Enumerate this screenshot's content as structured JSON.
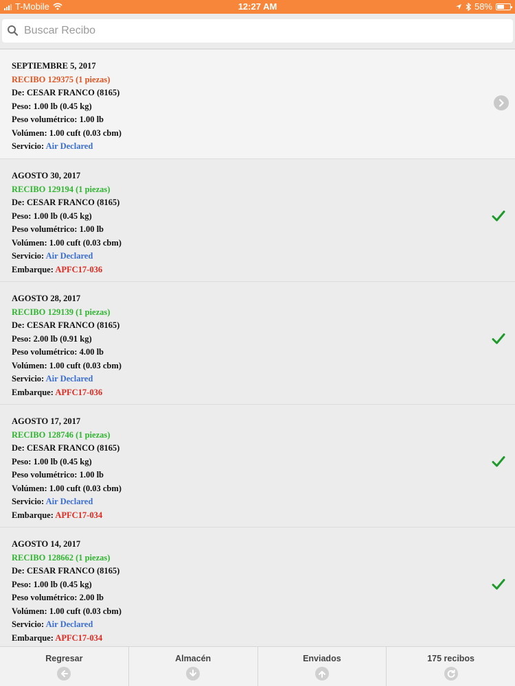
{
  "status_bar": {
    "carrier": "T-Mobile",
    "time": "12:27 AM",
    "battery": "58%",
    "battery_level": 0.58,
    "icons": [
      "signal-icon",
      "wifi-icon",
      "location-icon",
      "bluetooth-icon",
      "battery-icon"
    ]
  },
  "search": {
    "placeholder": "Buscar Recibo",
    "value": ""
  },
  "labels": {
    "de": "De:",
    "peso": "Peso:",
    "peso_vol": "Peso volumétrico:",
    "volumen": "Volúmen:",
    "servicio": "Servicio:",
    "embarque": "Embarque:"
  },
  "receipts": [
    {
      "date": "SEPTIEMBRE 5, 2017",
      "recibo": "RECIBO 129375 (1 piezas)",
      "de": "CESAR FRANCO (8165)",
      "peso": "1.00 lb (0.45 kg)",
      "peso_vol": "1.00 lb",
      "volumen": "1.00 cuft (0.03 cbm)",
      "servicio": "Air Declared",
      "embarque": "",
      "status_icon": "chevron-right-icon",
      "recibo_color": "#e0531f"
    },
    {
      "date": "AGOSTO 30, 2017",
      "recibo": "RECIBO 129194 (1 piezas)",
      "de": "CESAR FRANCO (8165)",
      "peso": "1.00 lb (0.45 kg)",
      "peso_vol": "1.00 lb",
      "volumen": "1.00 cuft (0.03 cbm)",
      "servicio": "Air Declared",
      "embarque": "APFC17-036",
      "status_icon": "check-icon",
      "recibo_color": "#2fb52f"
    },
    {
      "date": "AGOSTO 28, 2017",
      "recibo": "RECIBO 129139 (1 piezas)",
      "de": "CESAR FRANCO (8165)",
      "peso": "2.00 lb (0.91 kg)",
      "peso_vol": "4.00 lb",
      "volumen": "1.00 cuft (0.03 cbm)",
      "servicio": "Air Declared",
      "embarque": "APFC17-036",
      "status_icon": "check-icon",
      "recibo_color": "#2fb52f"
    },
    {
      "date": "AGOSTO 17, 2017",
      "recibo": "RECIBO 128746 (1 piezas)",
      "de": "CESAR FRANCO (8165)",
      "peso": "1.00 lb (0.45 kg)",
      "peso_vol": "1.00 lb",
      "volumen": "1.00 cuft (0.03 cbm)",
      "servicio": "Air Declared",
      "embarque": "APFC17-034",
      "status_icon": "check-icon",
      "recibo_color": "#2fb52f"
    },
    {
      "date": "AGOSTO 14, 2017",
      "recibo": "RECIBO 128662 (1 piezas)",
      "de": "CESAR FRANCO (8165)",
      "peso": "1.00 lb (0.45 kg)",
      "peso_vol": "2.00 lb",
      "volumen": "1.00 cuft (0.03 cbm)",
      "servicio": "Air Declared",
      "embarque": "APFC17-034",
      "status_icon": "check-icon",
      "recibo_color": "#2fb52f"
    }
  ],
  "tabbar": [
    {
      "label": "Regresar",
      "icon": "arrow-left-icon"
    },
    {
      "label": "Almacén",
      "icon": "arrow-down-icon"
    },
    {
      "label": "Enviados",
      "icon": "arrow-up-icon"
    },
    {
      "label": "175 recibos",
      "icon": "refresh-icon"
    }
  ],
  "colors": {
    "status_bar": "#f7863a",
    "recibo_green": "#2fb52f",
    "recibo_orange": "#e0531f",
    "service_blue": "#3b6fd6",
    "shipment_red": "#e0281f",
    "check_green": "#1e9a2a"
  }
}
